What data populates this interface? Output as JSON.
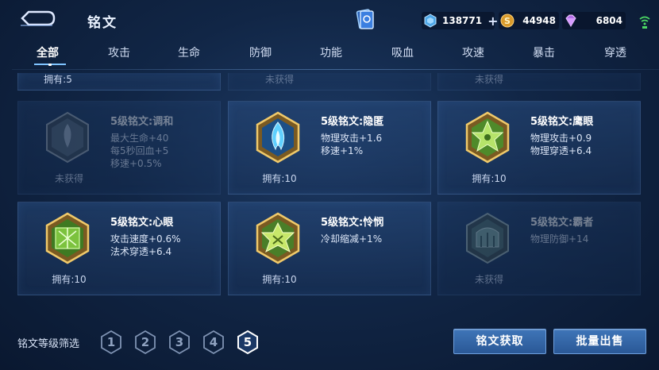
{
  "header": {
    "title": "铭文",
    "currencies": [
      {
        "name": "coupon",
        "icon": "coupon-icon",
        "value": "138771",
        "has_plus": true
      },
      {
        "name": "gold",
        "icon": "gold-coin-icon",
        "value": "44948"
      },
      {
        "name": "gem",
        "icon": "diamond-icon",
        "value": "6804"
      }
    ],
    "plus_symbol": "+"
  },
  "tabs": [
    "全部",
    "攻击",
    "生命",
    "防御",
    "功能",
    "吸血",
    "攻速",
    "暴击",
    "穿透"
  ],
  "active_tab": 0,
  "top_row": [
    {
      "owned": "拥有:5",
      "obtained": true
    },
    {
      "owned": "未获得",
      "obtained": false
    },
    {
      "owned": "未获得",
      "obtained": false
    }
  ],
  "runes": [
    {
      "name": "5级铭文:调和",
      "attrs": [
        "最大生命+40",
        "每5秒回血+5",
        "移速+0.5%"
      ],
      "owned": "未获得",
      "obtained": false,
      "color": "#8aa0b8",
      "icon": "harmony-rune-icon"
    },
    {
      "name": "5级铭文:隐匿",
      "attrs": [
        "物理攻击+1.6",
        "移速+1%"
      ],
      "owned": "拥有:10",
      "obtained": true,
      "color": "#4fc3f7",
      "icon": "stealth-rune-icon"
    },
    {
      "name": "5级铭文:鹰眼",
      "attrs": [
        "物理攻击+0.9",
        "物理穿透+6.4"
      ],
      "owned": "拥有:10",
      "obtained": true,
      "color": "#8bc34a",
      "icon": "hawkeye-rune-icon"
    },
    {
      "name": "5级铭文:心眼",
      "attrs": [
        "攻击速度+0.6%",
        "法术穿透+6.4"
      ],
      "owned": "拥有:10",
      "obtained": true,
      "color": "#7cb342",
      "icon": "mind-eye-rune-icon"
    },
    {
      "name": "5级铭文:怜悯",
      "attrs": [
        "冷却缩减+1%"
      ],
      "owned": "拥有:10",
      "obtained": true,
      "color": "#9ccc65",
      "icon": "mercy-rune-icon"
    },
    {
      "name": "5级铭文:霸者",
      "attrs": [
        "物理防御+14"
      ],
      "owned": "未获得",
      "obtained": false,
      "color": "#6fa0a0",
      "icon": "overlord-rune-icon"
    }
  ],
  "filter": {
    "label": "铭文等级筛选",
    "levels": [
      "1",
      "2",
      "3",
      "4",
      "5"
    ],
    "selected": "5"
  },
  "buttons": {
    "get": "铭文获取",
    "sell": "批量出售"
  }
}
